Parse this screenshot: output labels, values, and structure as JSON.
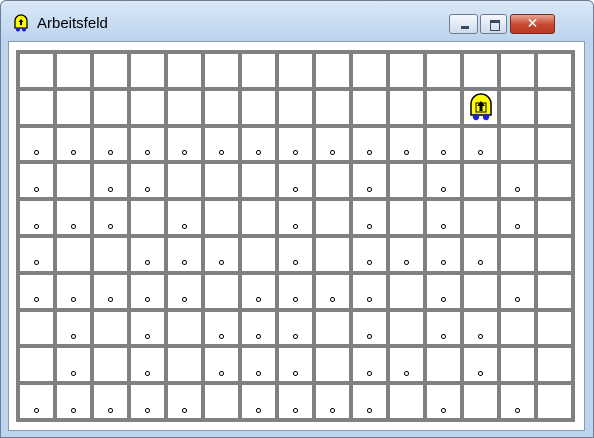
{
  "window": {
    "title": "Arbeitsfeld",
    "buttons": {
      "minimize": "minimize",
      "maximize": "maximize",
      "close": "close"
    }
  },
  "grid": {
    "rows": 10,
    "cols": 15,
    "dots": [
      [
        2,
        0
      ],
      [
        2,
        1
      ],
      [
        2,
        2
      ],
      [
        2,
        3
      ],
      [
        2,
        4
      ],
      [
        2,
        5
      ],
      [
        2,
        6
      ],
      [
        2,
        7
      ],
      [
        2,
        8
      ],
      [
        2,
        9
      ],
      [
        2,
        10
      ],
      [
        2,
        11
      ],
      [
        2,
        12
      ],
      [
        3,
        0
      ],
      [
        3,
        2
      ],
      [
        3,
        3
      ],
      [
        3,
        7
      ],
      [
        3,
        9
      ],
      [
        3,
        11
      ],
      [
        3,
        13
      ],
      [
        4,
        0
      ],
      [
        4,
        1
      ],
      [
        4,
        2
      ],
      [
        4,
        4
      ],
      [
        4,
        7
      ],
      [
        4,
        9
      ],
      [
        4,
        11
      ],
      [
        4,
        13
      ],
      [
        5,
        0
      ],
      [
        5,
        3
      ],
      [
        5,
        4
      ],
      [
        5,
        5
      ],
      [
        5,
        7
      ],
      [
        5,
        9
      ],
      [
        5,
        10
      ],
      [
        5,
        11
      ],
      [
        5,
        12
      ],
      [
        6,
        0
      ],
      [
        6,
        1
      ],
      [
        6,
        2
      ],
      [
        6,
        3
      ],
      [
        6,
        4
      ],
      [
        6,
        6
      ],
      [
        6,
        7
      ],
      [
        6,
        8
      ],
      [
        6,
        9
      ],
      [
        6,
        11
      ],
      [
        6,
        13
      ],
      [
        7,
        1
      ],
      [
        7,
        3
      ],
      [
        7,
        5
      ],
      [
        7,
        6
      ],
      [
        7,
        7
      ],
      [
        7,
        9
      ],
      [
        7,
        11
      ],
      [
        7,
        12
      ],
      [
        8,
        1
      ],
      [
        8,
        3
      ],
      [
        8,
        5
      ],
      [
        8,
        6
      ],
      [
        8,
        7
      ],
      [
        8,
        9
      ],
      [
        8,
        10
      ],
      [
        8,
        12
      ],
      [
        9,
        0
      ],
      [
        9,
        1
      ],
      [
        9,
        2
      ],
      [
        9,
        3
      ],
      [
        9,
        4
      ],
      [
        9,
        6
      ],
      [
        9,
        7
      ],
      [
        9,
        8
      ],
      [
        9,
        9
      ],
      [
        9,
        11
      ],
      [
        9,
        13
      ]
    ],
    "robot": {
      "row": 1,
      "col": 12,
      "facing": "north"
    }
  },
  "icons": {
    "app": "robot-icon",
    "close": "close-icon"
  },
  "colors": {
    "grid_line": "#808080",
    "robot_body": "#ffff00",
    "robot_wheels": "#1f1fd6",
    "close_button": "#c7462e"
  }
}
